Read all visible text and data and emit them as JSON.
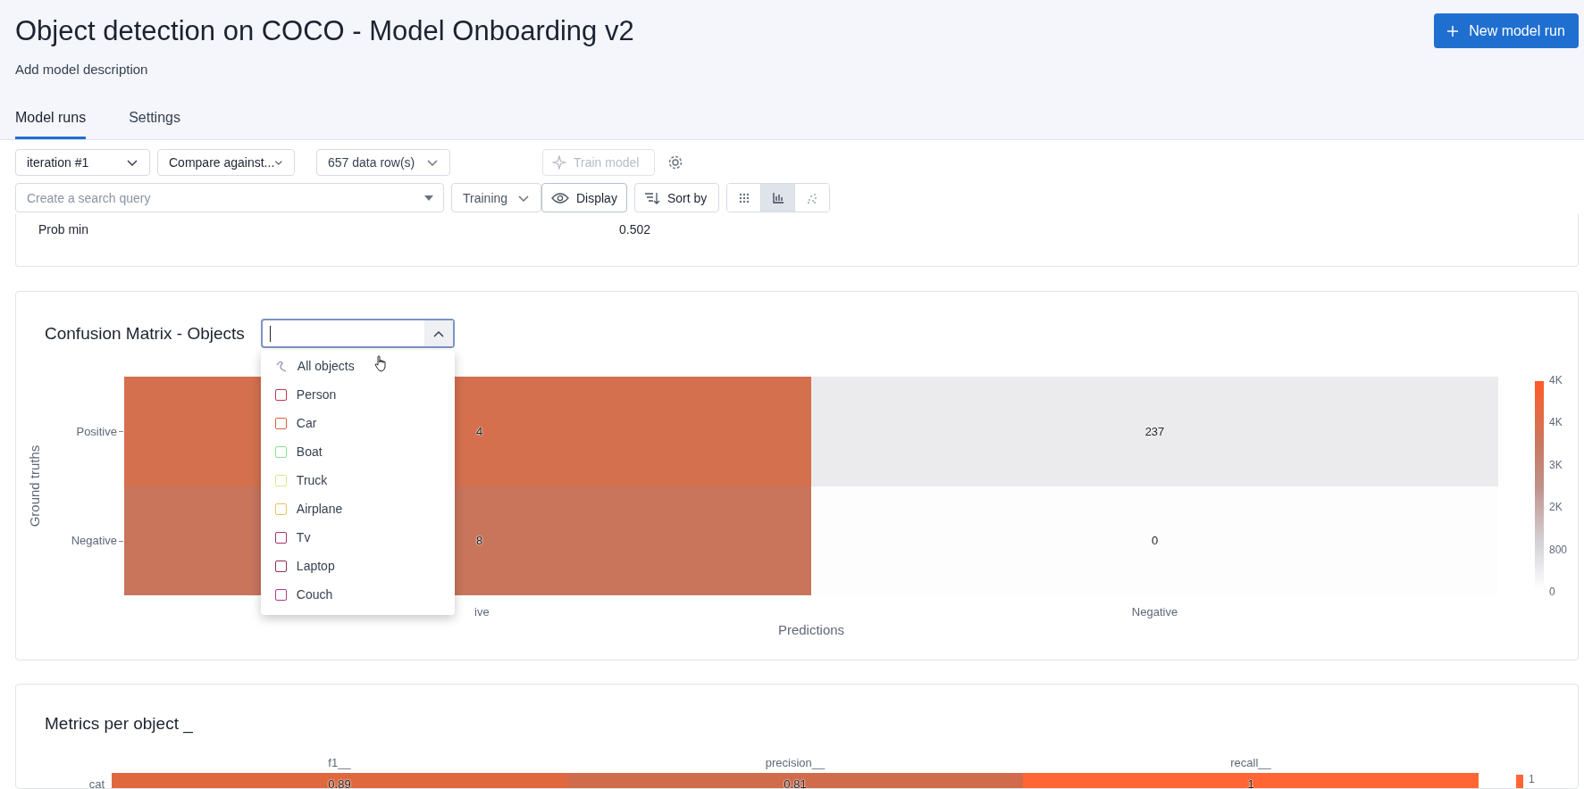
{
  "header": {
    "title": "Object detection on COCO - Model Onboarding v2",
    "description": "Add model description",
    "new_run_button": "New model run"
  },
  "tabs": [
    {
      "label": "Model runs",
      "selected": true
    },
    {
      "label": "Settings",
      "selected": false
    }
  ],
  "toolbar": {
    "iteration": "iteration #1",
    "compare": "Compare against...",
    "data_rows": "657 data row(s)",
    "train_button": {
      "label": "Train model",
      "disabled": true
    },
    "search": {
      "placeholder": "Create a search query"
    },
    "split": "Training",
    "display_button": "Display",
    "sort_button": "Sort by",
    "views": [
      {
        "kind": "grid",
        "selected": false
      },
      {
        "kind": "bars",
        "selected": true
      },
      {
        "kind": "scatter",
        "selected": false
      }
    ]
  },
  "stats": [
    {
      "label": "Prob min",
      "value": "0.502"
    }
  ],
  "confusion_matrix": {
    "title": "Confusion Matrix - Objects",
    "object_filter": {
      "open": true,
      "options": [
        {
          "kind": "all",
          "label": "All objects"
        },
        {
          "kind": "object",
          "label": "Person",
          "color": "#c8344a",
          "checked": false
        },
        {
          "kind": "object",
          "label": "Car",
          "color": "#d9603b",
          "checked": false
        },
        {
          "kind": "object",
          "label": "Boat",
          "color": "#8ee08e",
          "checked": false
        },
        {
          "kind": "object",
          "label": "Truck",
          "color": "#d4ee8a",
          "checked": false
        },
        {
          "kind": "object",
          "label": "Airplane",
          "color": "#e6c25e",
          "checked": false
        },
        {
          "kind": "object",
          "label": "Tv",
          "color": "#a3316e",
          "checked": false
        },
        {
          "kind": "object",
          "label": "Laptop",
          "color": "#8e2e58",
          "checked": false
        },
        {
          "kind": "object",
          "label": "Couch",
          "color": "#b03a8e",
          "checked": false
        }
      ]
    },
    "ylabel": "Ground truths",
    "xlabel": "Predictions",
    "row_labels": [
      "Positive",
      "Negative"
    ],
    "column_labels": [
      "ive",
      "Negative"
    ],
    "cells": [
      [
        {
          "text": "4",
          "color": "#d4704e"
        },
        {
          "text": "237",
          "color": "#ebebed"
        }
      ],
      [
        {
          "text": "8",
          "color": "#c8755c"
        },
        {
          "text": "0",
          "color": "#fdfdfd"
        }
      ]
    ],
    "colorbar_ticks": [
      "4K",
      "4K",
      "3K",
      "2K",
      "800",
      "0"
    ]
  },
  "metrics": {
    "title": "Metrics per object _",
    "columns": [
      "f1__",
      "precision__",
      "recall__"
    ],
    "rows": [
      {
        "label": "cat",
        "cells": [
          {
            "text": "0.89",
            "color": "#e0683f"
          },
          {
            "text": "0.81",
            "color": "#d06c4c"
          },
          {
            "text": "1",
            "color": "#ff6633"
          }
        ]
      }
    ],
    "colorbar_ticks": [
      "1"
    ]
  }
}
